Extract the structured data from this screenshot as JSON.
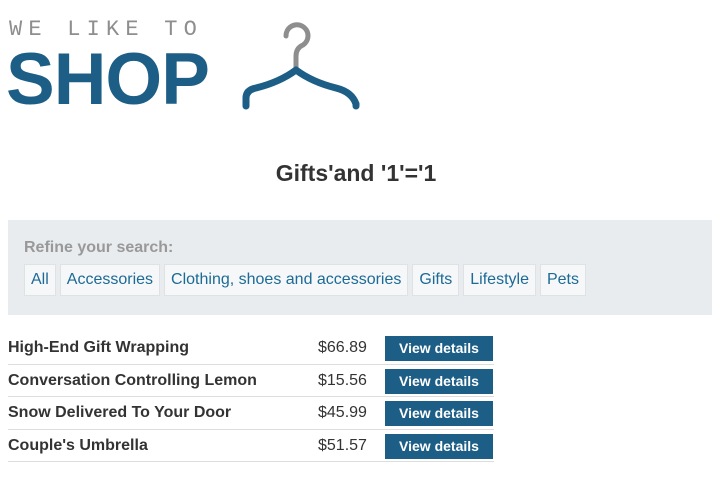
{
  "logo": {
    "tagline": "WE LIKE TO",
    "wordmark": "SHOP",
    "icon": "hanger-icon",
    "brand_color": "#1d5e86",
    "tagline_color": "#8e8e8e"
  },
  "search": {
    "title": "Gifts'and '1'='1"
  },
  "filters": {
    "label": "Refine your search:",
    "categories": [
      {
        "label": "All"
      },
      {
        "label": "Accessories"
      },
      {
        "label": "Clothing, shoes and accessories"
      },
      {
        "label": "Gifts"
      },
      {
        "label": "Lifestyle"
      },
      {
        "label": "Pets"
      }
    ]
  },
  "products": [
    {
      "name": "High-End Gift Wrapping",
      "price": "$66.89",
      "button": "View details"
    },
    {
      "name": "Conversation Controlling Lemon",
      "price": "$15.56",
      "button": "View details"
    },
    {
      "name": "Snow Delivered To Your Door",
      "price": "$45.99",
      "button": "View details"
    },
    {
      "name": "Couple's Umbrella",
      "price": "$51.57",
      "button": "View details"
    }
  ],
  "colors": {
    "link": "#1d6a96",
    "panel_background": "#e8ecef",
    "button_background": "#1d5e86"
  }
}
